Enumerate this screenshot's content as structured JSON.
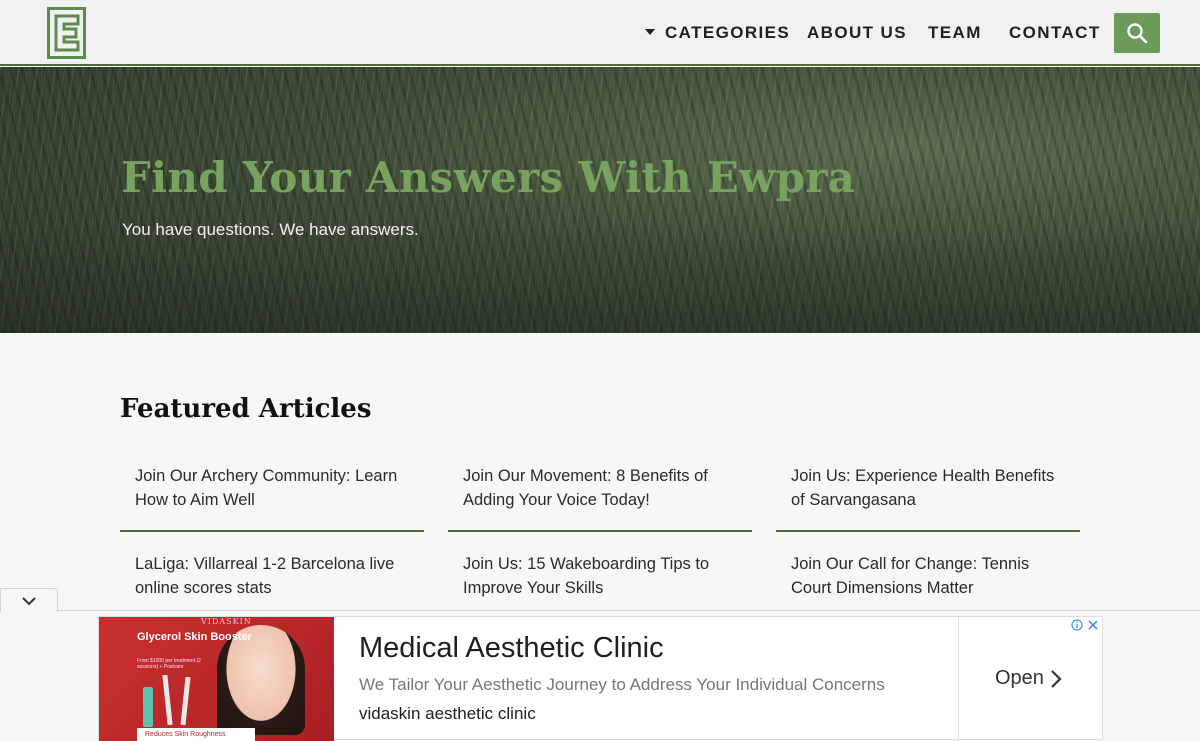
{
  "header": {
    "logo_icon": "ewpra-logo",
    "nav": {
      "categories": "CATEGORIES",
      "about": "ABOUT US",
      "team": "TEAM",
      "contact": "CONTACT"
    },
    "search_icon": "search-icon",
    "accent_color": "#6b9a5b"
  },
  "hero": {
    "title": "Find Your Answers With Ewpra",
    "subtitle": "You have questions. We have answers."
  },
  "featured": {
    "heading": "Featured Articles",
    "articles": [
      "Join Our Archery Community: Learn How to Aim Well",
      "Join Our Movement: 8 Benefits of Adding Your Voice Today!",
      "Join Us: Experience Health Benefits of Sarvangasana",
      "LaLiga: Villarreal 1-2 Barcelona live online scores stats",
      "Join Us: 15 Wakeboarding Tips to Improve Your Skills",
      "Join Our Call for Change: Tennis Court Dimensions Matter"
    ]
  },
  "ad": {
    "image": {
      "brand": "VIDASKIN",
      "promo_title": "Glycerol Skin Booster",
      "promo_detail": "From $1000 per treatment (2 sessions) + Postcare",
      "tag": "Reduces Skin Roughness"
    },
    "headline": "Medical Aesthetic Clinic",
    "description": "We Tailor Your Aesthetic Journey to Address Your Individual Concerns",
    "source": "vidaskin aesthetic clinic",
    "cta": "Open"
  }
}
